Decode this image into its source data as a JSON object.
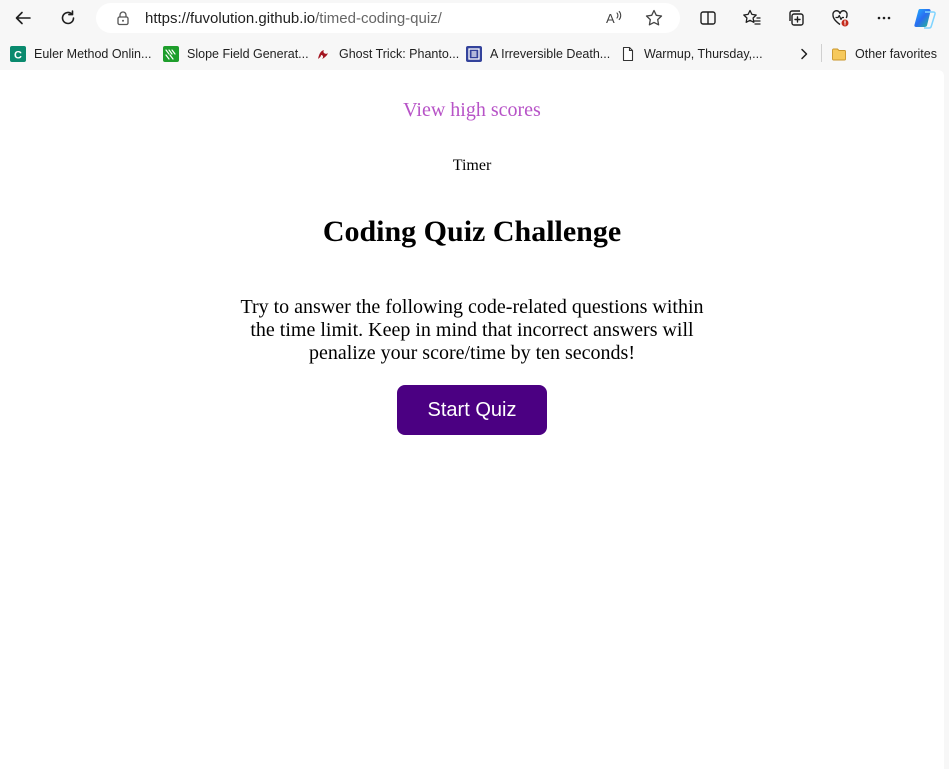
{
  "browser": {
    "url_host": "https://fuvolution.github.io",
    "url_path": "/timed-coding-quiz/",
    "icons": [
      "back-icon",
      "refresh-icon",
      "lock-icon",
      "read-aloud-icon",
      "favorite-star-icon",
      "split-screen-icon",
      "favorites-icon",
      "collections-icon",
      "browser-essentials-icon",
      "more-icon",
      "copilot-icon"
    ]
  },
  "bookmarks": {
    "items": [
      {
        "label": "Euler Method Onlin...",
        "icon": "calculator-icon"
      },
      {
        "label": "Slope Field Generat...",
        "icon": "geogebra-icon"
      },
      {
        "label": "Ghost Trick: Phanto...",
        "icon": "ghost-trick-icon"
      },
      {
        "label": "A Irreversible Death...",
        "icon": "archive-icon"
      },
      {
        "label": "Warmup, Thursday,...",
        "icon": "page-icon"
      }
    ],
    "other_favorites": "Other favorites"
  },
  "page": {
    "high_scores_link": "View high scores",
    "timer": "Timer",
    "title": "Coding Quiz Challenge",
    "intro": "Try to answer the following code-related questions within the time limit. Keep in mind that incorrect answers will penalize your score/time by ten seconds!",
    "start_button": "Start Quiz"
  },
  "colors": {
    "link": "#b753c7",
    "button_bg": "#4b0082",
    "button_text": "#ffffff"
  }
}
